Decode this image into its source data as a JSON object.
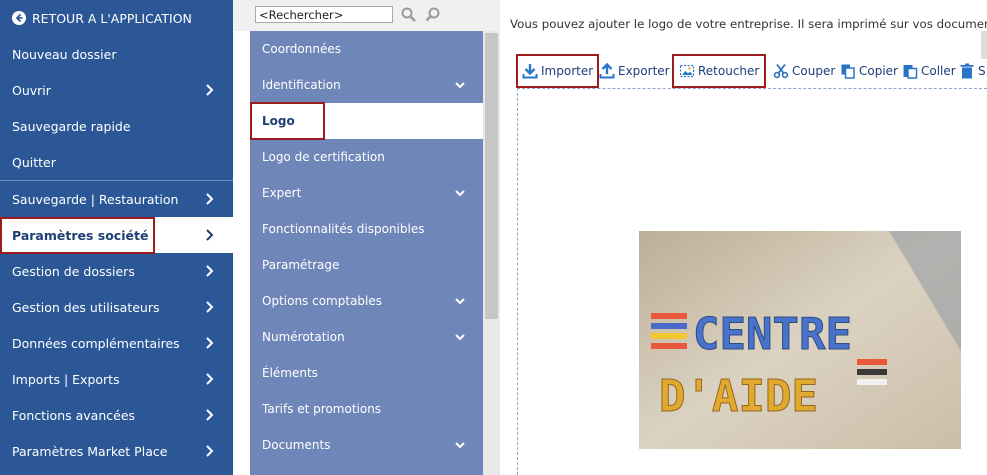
{
  "nav": {
    "back_label": "RETOUR A L'APPLICATION",
    "items": [
      {
        "label": "Nouveau dossier"
      },
      {
        "label": "Ouvrir"
      },
      {
        "label": "Sauvegarde rapide"
      },
      {
        "label": "Quitter"
      },
      {
        "label": "Sauvegarde | Restauration"
      },
      {
        "label": "Paramètres société"
      },
      {
        "label": "Gestion de dossiers"
      },
      {
        "label": "Gestion des utilisateurs"
      },
      {
        "label": "Données complémentaires"
      },
      {
        "label": "Imports | Exports"
      },
      {
        "label": "Fonctions avancées"
      },
      {
        "label": "Paramètres Market Place"
      }
    ],
    "active": "Paramètres société"
  },
  "search": {
    "placeholder": "<Rechercher>"
  },
  "submenu": {
    "items": [
      {
        "label": "Coordonnées"
      },
      {
        "label": "Identification"
      },
      {
        "label": "Logo"
      },
      {
        "label": "Logo de certification"
      },
      {
        "label": "Expert"
      },
      {
        "label": "Fonctionnalités disponibles"
      },
      {
        "label": "Paramétrage"
      },
      {
        "label": "Options comptables"
      },
      {
        "label": "Numérotation"
      },
      {
        "label": "Éléments"
      },
      {
        "label": "Tarifs et promotions"
      },
      {
        "label": "Documents"
      }
    ],
    "active": "Logo"
  },
  "content": {
    "info": "Vous pouvez ajouter le logo de votre entreprise. Il sera imprimé sur vos documents.",
    "toolbar": {
      "import": "Importer",
      "export": "Exporter",
      "retouch": "Retoucher",
      "cut": "Couper",
      "copy": "Copier",
      "paste": "Coller",
      "delete": "S"
    },
    "logo_text": {
      "line1": "CENTRE",
      "line2": "D'AIDE"
    }
  },
  "colors": {
    "nav_bg": "#2b5797",
    "submenu_bg": "#6f86b9",
    "highlight": "#9b1c1c",
    "toolbar_text": "#1e3e78"
  }
}
